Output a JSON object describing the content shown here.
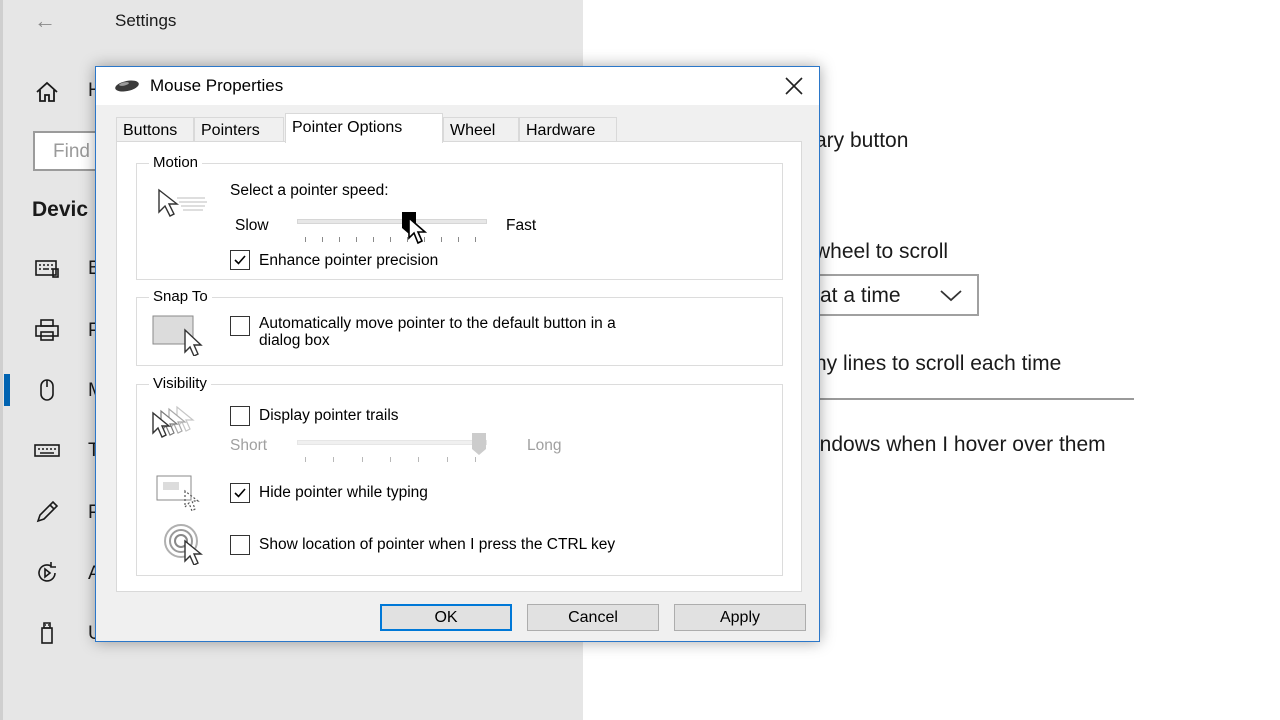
{
  "settings": {
    "title": "Settings",
    "back_glyph": "←",
    "search_placeholder": "Find",
    "section_heading": "Devic",
    "sidebar_peeks": [
      "H",
      "B",
      "P",
      "M",
      "T",
      "P",
      "A",
      "U"
    ],
    "right_fragments": {
      "primary_button": "ary button",
      "roll_wheel": "wheel to scroll",
      "dropdown_value": "at a time",
      "lines_label": "ny lines to scroll each time",
      "inactive_windows": "indows when I hover over them"
    },
    "accent_color": "#0063b1"
  },
  "dialog": {
    "title": "Mouse Properties",
    "tabs": [
      {
        "label": "Buttons"
      },
      {
        "label": "Pointers"
      },
      {
        "label": "Pointer Options",
        "active": true
      },
      {
        "label": "Wheel"
      },
      {
        "label": "Hardware"
      }
    ],
    "motion": {
      "group_label": "Motion",
      "speed_label": "Select a pointer speed:",
      "slow_label": "Slow",
      "fast_label": "Fast",
      "speed_value": 6,
      "speed_max": 10,
      "precision_label": "Enhance pointer precision",
      "precision_checked": true
    },
    "snap_to": {
      "group_label": "Snap To",
      "label_line1": "Automatically move pointer to the default button in a",
      "label_line2": "dialog box",
      "checked": false
    },
    "visibility": {
      "group_label": "Visibility",
      "trails_label": "Display pointer trails",
      "trails_checked": false,
      "short_label": "Short",
      "long_label": "Long",
      "trail_length_value": 1.0,
      "hide_label": "Hide pointer while typing",
      "hide_checked": true,
      "ctrl_label": "Show location of pointer when I press the CTRL key",
      "ctrl_checked": false
    },
    "buttons": {
      "ok": "OK",
      "cancel": "Cancel",
      "apply": "Apply"
    },
    "accent_color": "#0078d7"
  }
}
